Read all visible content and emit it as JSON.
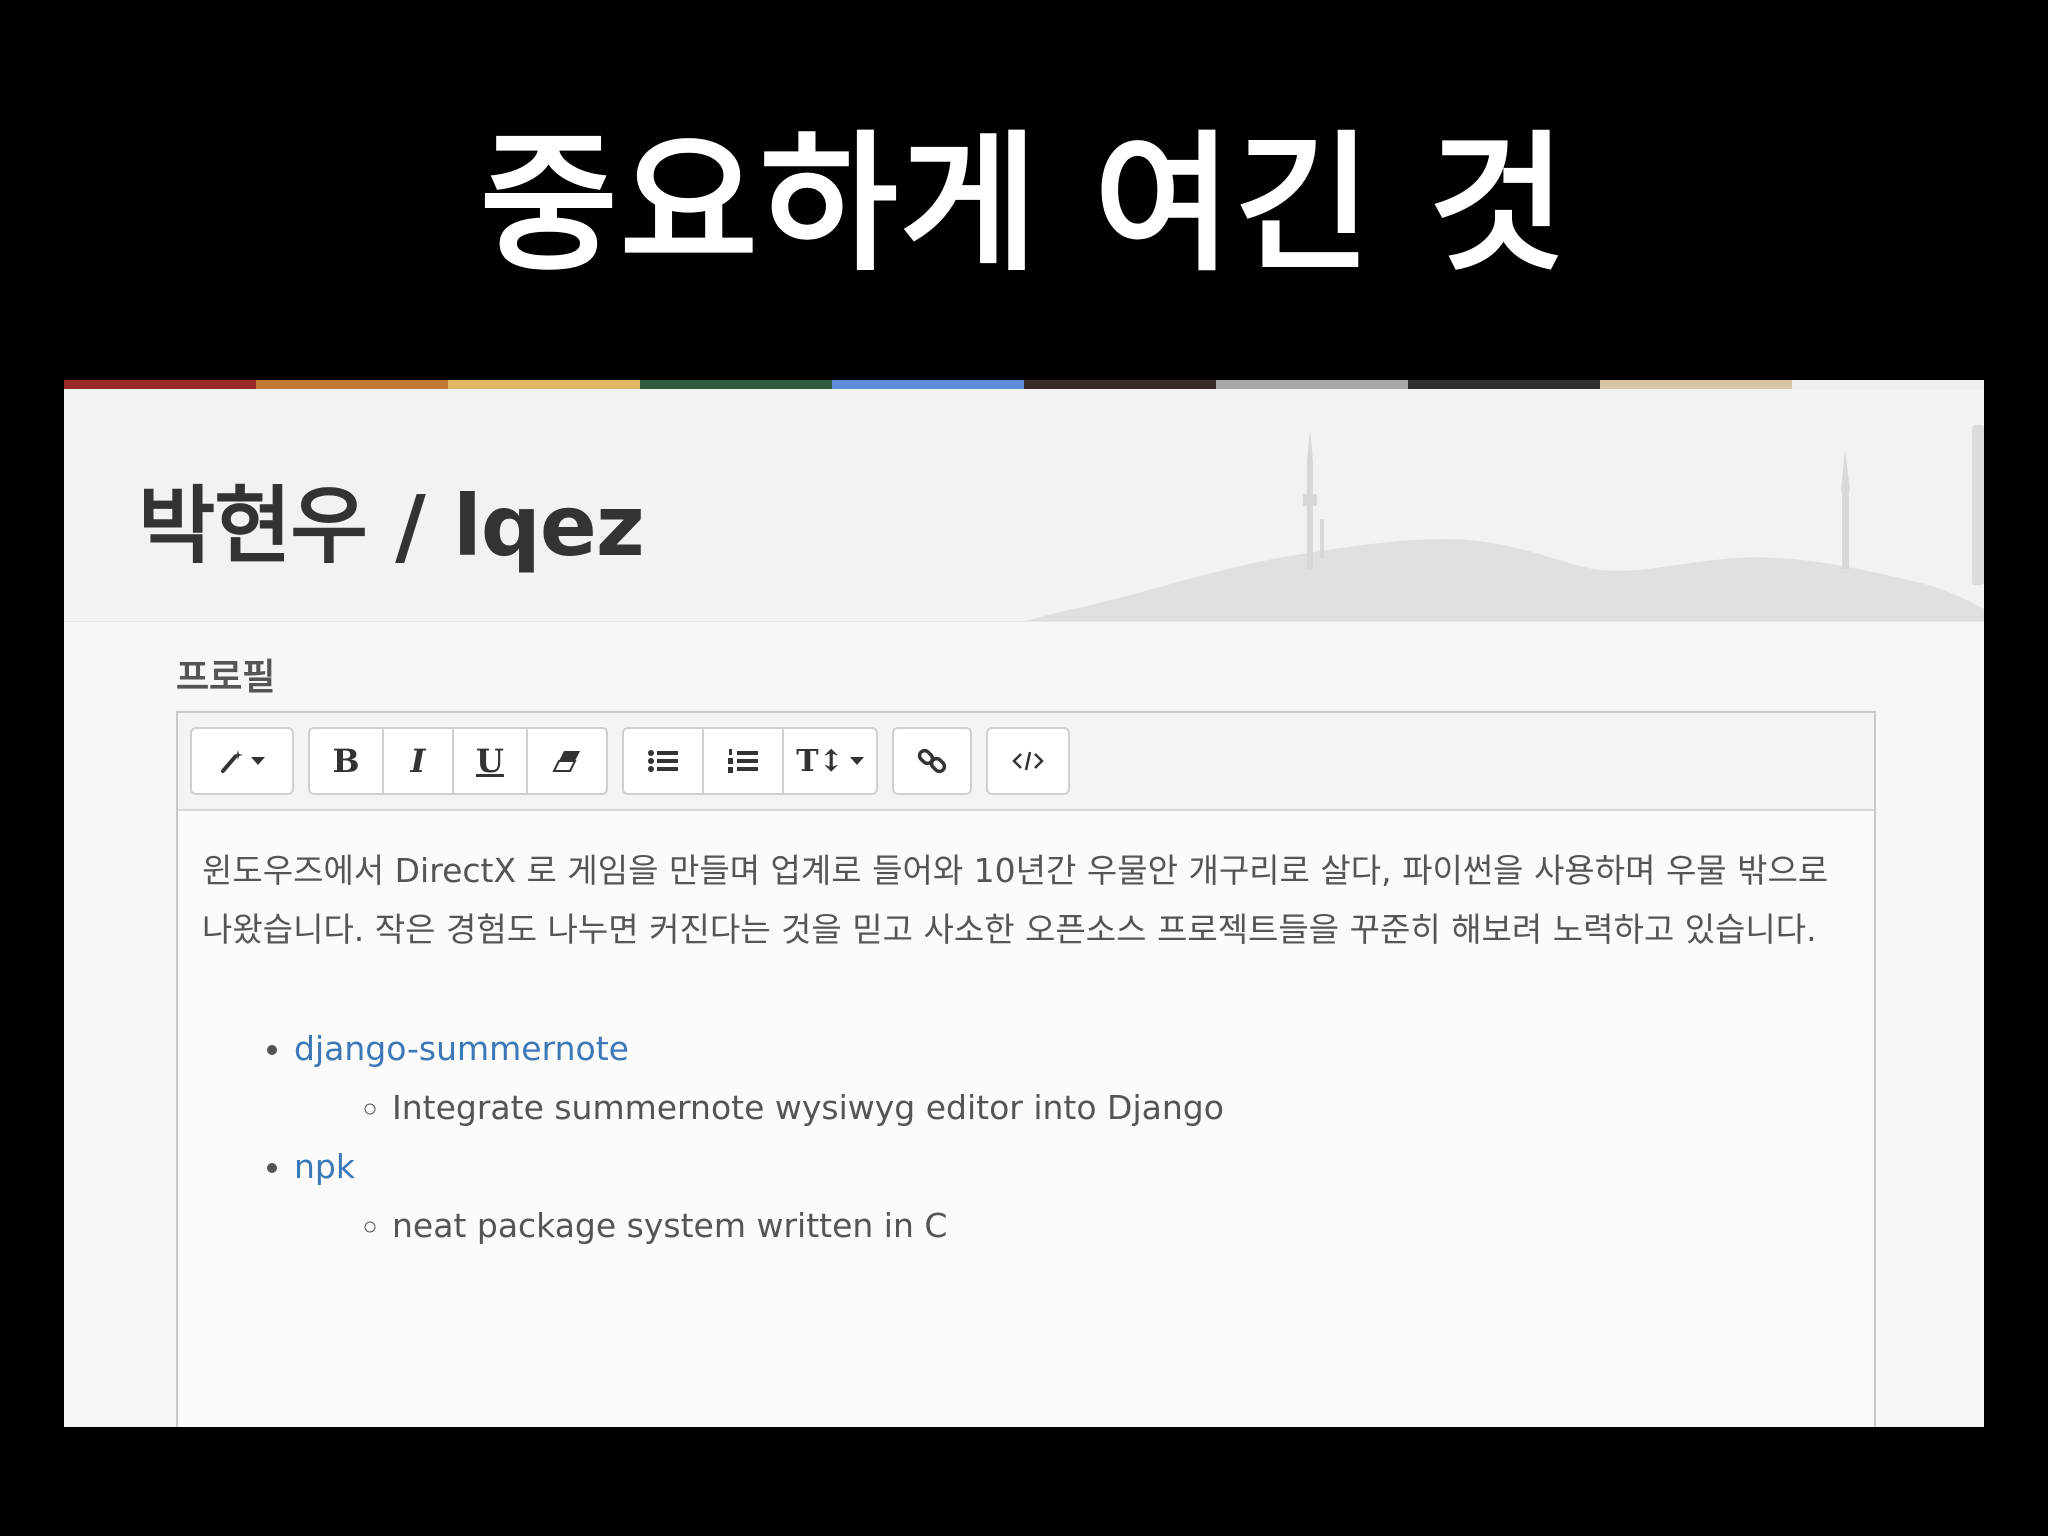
{
  "slide": {
    "title": "중요하게 여긴 것"
  },
  "colors": {
    "stripe": [
      "#9a2a2a",
      "#c07a33",
      "#e0b865",
      "#2f5a3e",
      "#5b8dd6",
      "#3a2a2a",
      "#a8a8a8",
      "#2e2e2e",
      "#d9c4a6",
      "#eeeeee"
    ],
    "link": "#3c78b8"
  },
  "page": {
    "title": "박현우 / lqez",
    "section_label": "프로필"
  },
  "toolbar": {
    "style_icon": "magic-wand-icon",
    "bold": "B",
    "italic": "I",
    "underline": "U",
    "eraser_icon": "eraser-icon",
    "ul_icon": "unordered-list-icon",
    "ol_icon": "ordered-list-icon",
    "font_size": "T↕",
    "link_icon": "link-icon",
    "code_icon": "code-view-icon"
  },
  "editor": {
    "intro": "윈도우즈에서 DirectX 로 게임을 만들며 업계로 들어와 10년간 우물안 개구리로 살다, 파이썬을 사용하며 우물 밖으로 나왔습니다. 작은 경험도 나누면 커진다는 것을 믿고 사소한 오픈소스 프로젝트들을 꾸준히 해보려 노력하고 있습니다.",
    "projects": [
      {
        "name": "django-summernote",
        "description": "Integrate summernote wysiwyg editor into Django"
      },
      {
        "name": "npk",
        "description": "neat package system written in C"
      }
    ]
  }
}
